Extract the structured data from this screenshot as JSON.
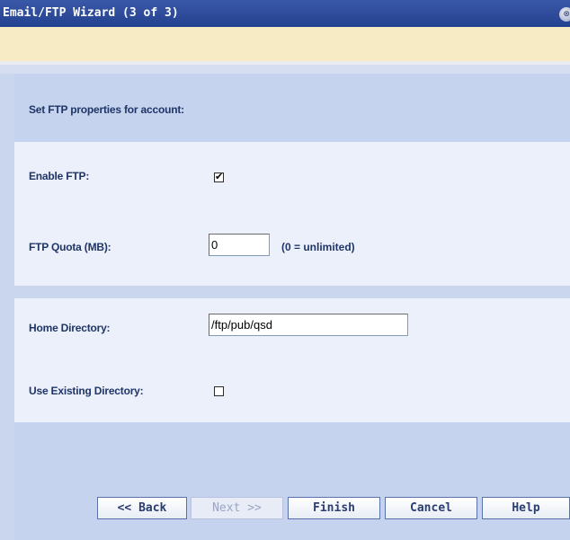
{
  "window": {
    "title": "Email/FTP Wizard (3 of 3)",
    "close_glyph": "⊗"
  },
  "section": {
    "heading": "Set FTP properties for account:"
  },
  "ftp": {
    "enable_label": "Enable FTP:",
    "enable_checked": true,
    "enable_mark": "✔",
    "quota_label": "FTP Quota (MB):",
    "quota_value": "0",
    "quota_hint": "(0 = unlimited)"
  },
  "directory": {
    "home_label": "Home Directory:",
    "home_value": "/ftp/pub/qsd",
    "use_existing_label": "Use Existing Directory:",
    "use_existing_checked": false,
    "use_existing_mark": ""
  },
  "buttons": {
    "back": "<< Back",
    "next": "Next >>",
    "finish": "Finish",
    "cancel": "Cancel",
    "help": "Help"
  },
  "icons": {
    "close": "close-icon",
    "check": "checkmark-icon"
  }
}
